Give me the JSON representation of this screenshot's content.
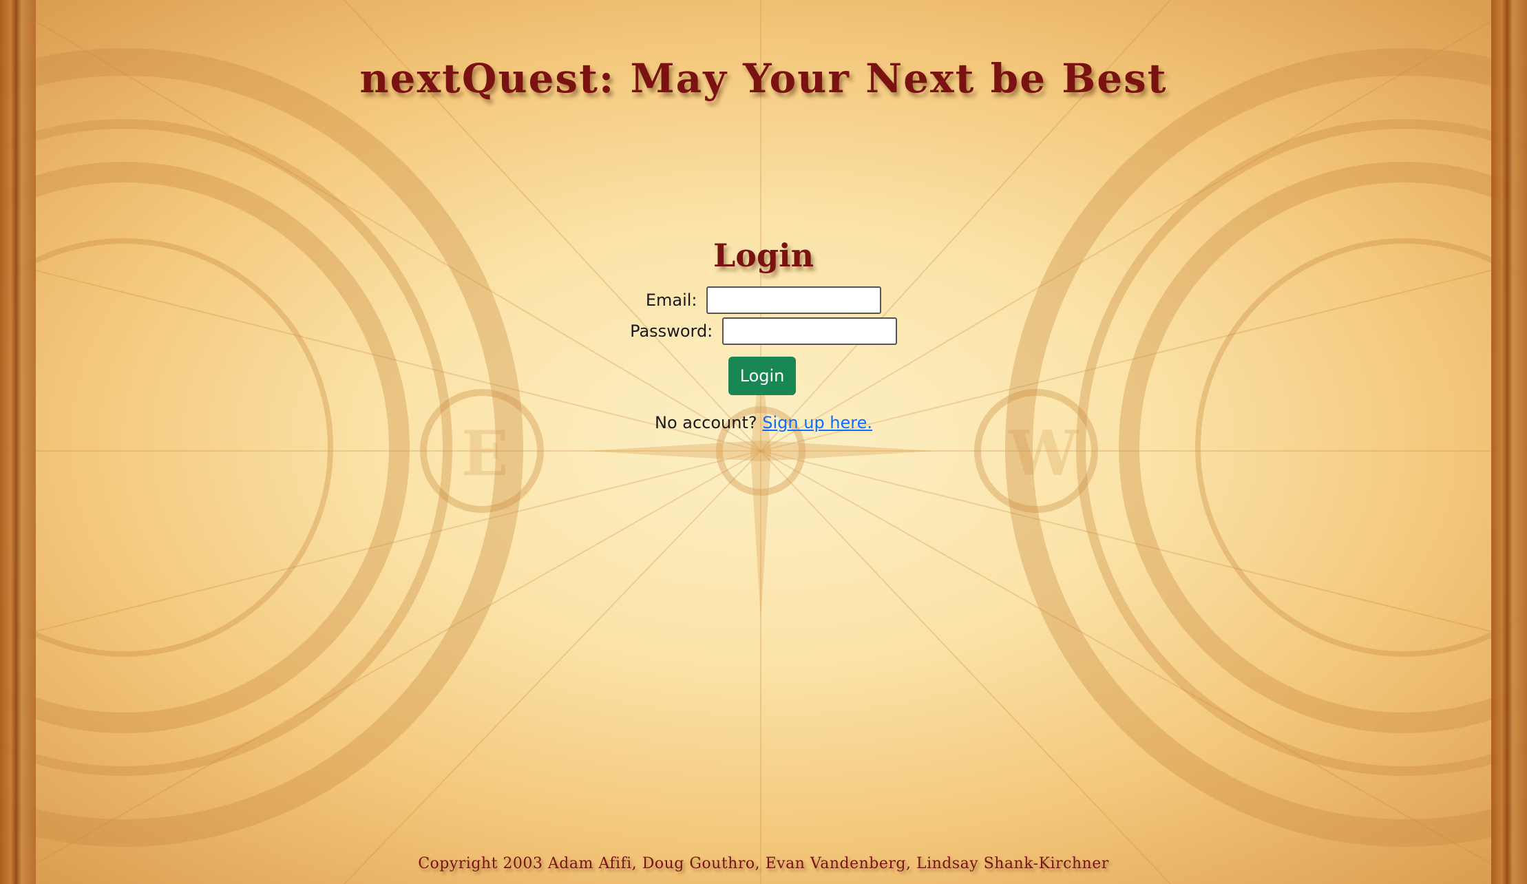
{
  "header": {
    "title": "nextQuest: May Your Next be Best"
  },
  "login": {
    "heading": "Login",
    "email_label": "Email:",
    "email_value": "",
    "password_label": "Password:",
    "password_value": "",
    "submit_label": "Login"
  },
  "signup": {
    "prompt": "No account?",
    "link_text": "Sign up here."
  },
  "footer": {
    "copyright": "Copyright 2003 Adam Afifi, Doug Gouthro, Evan Vandenberg, Lindsay Shank-Kirchner"
  },
  "colors": {
    "title_color": "#7a1212",
    "button_color": "#198754",
    "link_color": "#0d6efd",
    "parchment": "#fbe3a8"
  },
  "icons": {
    "background": "compass-map-background"
  }
}
